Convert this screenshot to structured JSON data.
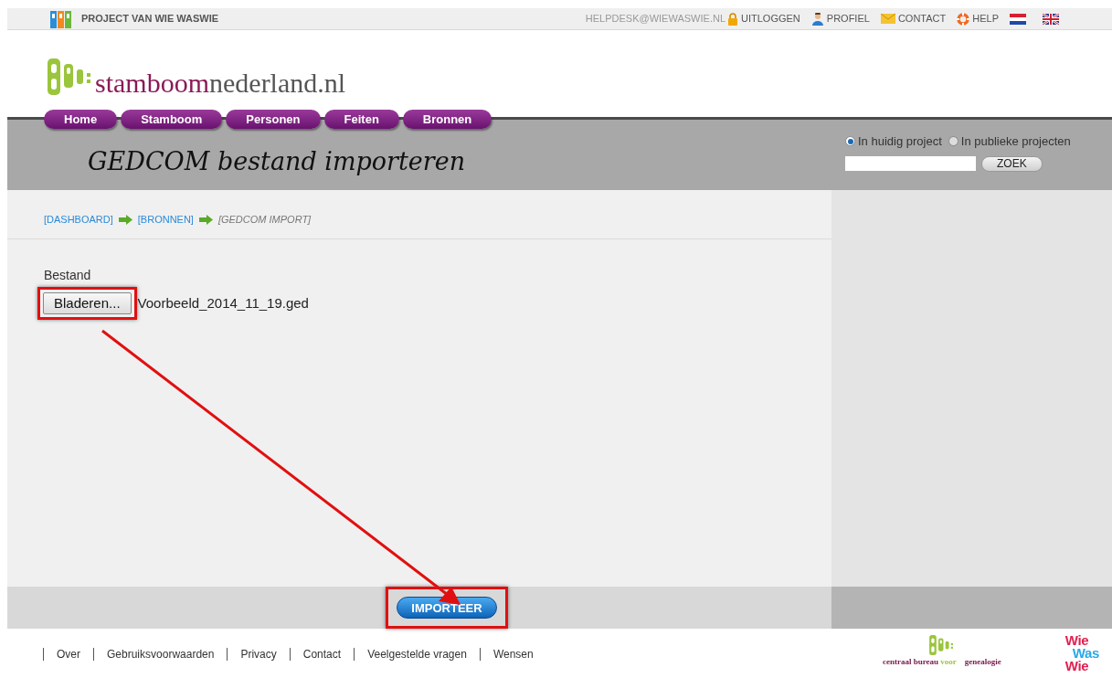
{
  "top_bar": {
    "project": "PROJECT VAN WIE WASWIE",
    "email": "HELPDESK@WIEWASWIE.NL",
    "links": [
      {
        "kind": "lock",
        "label": "UITLOGGEN"
      },
      {
        "kind": "person",
        "label": "PROFIEL"
      },
      {
        "kind": "mail",
        "label": "CONTACT"
      },
      {
        "kind": "help",
        "label": "HELP"
      }
    ]
  },
  "logo": {
    "part_1": "stamboom",
    "part_2": "nederland.nl"
  },
  "nav": [
    {
      "label": "Home"
    },
    {
      "label": "Stamboom"
    },
    {
      "label": "Personen"
    },
    {
      "label": "Feiten"
    },
    {
      "label": "Bronnen"
    }
  ],
  "banner": {
    "title": "GEDCOM bestand importeren"
  },
  "search": {
    "scopes": [
      {
        "label": "In huidig project",
        "selected": true
      },
      {
        "label": "In publieke projecten",
        "selected": false
      }
    ],
    "button": "ZOEK"
  },
  "breadcrumb": [
    {
      "label": "[DASHBOARD]",
      "kind": "link"
    },
    {
      "label": "[BRONNEN]",
      "kind": "link"
    },
    {
      "label": "[GEDCOM IMPORT]",
      "kind": "current"
    }
  ],
  "form": {
    "label": "Bestand",
    "browse_button": "Bladeren...",
    "file_name": "Voorbeeld_2014_11_19.ged",
    "submit": "IMPORTEER"
  },
  "footer": {
    "links": [
      "Over",
      "Gebruiksvoorwaarden",
      "Privacy",
      "Contact",
      "Veelgestelde vragen",
      "Wensen"
    ],
    "cbg": {
      "part_1": "centraal bureau",
      "part_2": "voor",
      "part_3": "genealogie"
    },
    "wiewaswie": [
      "Wie",
      "Was",
      "Wie"
    ]
  }
}
